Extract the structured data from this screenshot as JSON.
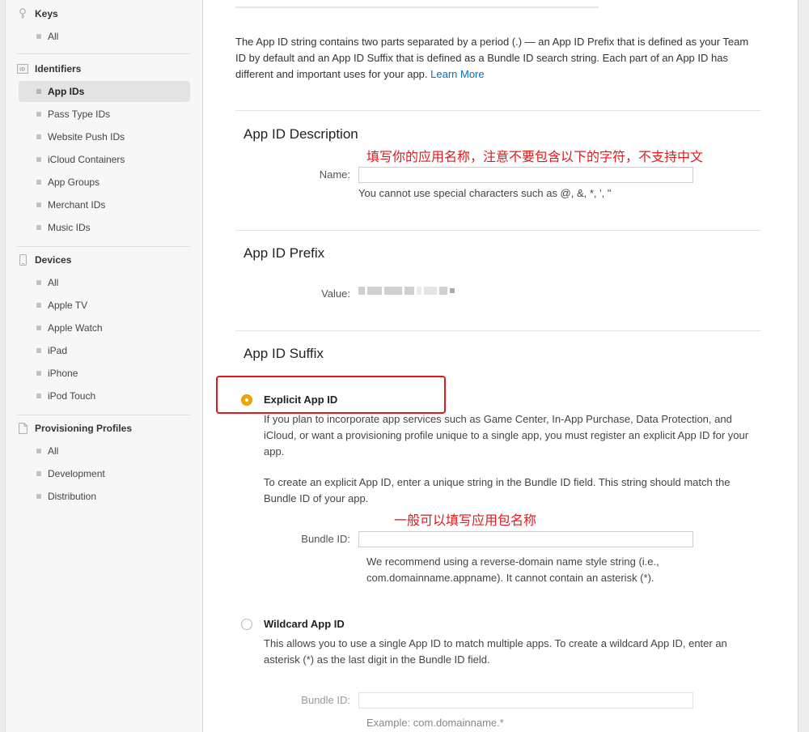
{
  "sidebar": {
    "keys": {
      "title": "Keys",
      "items": [
        "All"
      ]
    },
    "identifiers": {
      "title": "Identifiers",
      "items": [
        "App IDs",
        "Pass Type IDs",
        "Website Push IDs",
        "iCloud Containers",
        "App Groups",
        "Merchant IDs",
        "Music IDs"
      ],
      "active": "App IDs"
    },
    "devices": {
      "title": "Devices",
      "items": [
        "All",
        "Apple TV",
        "Apple Watch",
        "iPad",
        "iPhone",
        "iPod Touch"
      ]
    },
    "profiles": {
      "title": "Provisioning Profiles",
      "items": [
        "All",
        "Development",
        "Distribution"
      ]
    }
  },
  "intro": {
    "text": "The App ID string contains two parts separated by a period (.) — an App ID Prefix that is defined as your Team ID by default and an App ID Suffix that is defined as a Bundle ID search string. Each part of an App ID has different and important uses for your app.",
    "link": "Learn More"
  },
  "description": {
    "heading": "App ID Description",
    "annotation": "填写你的应用名称，注意不要包含以下的字符，不支持中文",
    "name_label": "Name:",
    "name_value": "",
    "hint": "You cannot use special characters such as @, &, *, ', \""
  },
  "prefix": {
    "heading": "App ID Prefix",
    "value_label": "Value:"
  },
  "suffix": {
    "heading": "App ID Suffix",
    "explicit": {
      "label": "Explicit App ID",
      "selected": true,
      "para1": "If you plan to incorporate app services such as Game Center, In-App Purchase, Data Protection, and iCloud, or want a provisioning profile unique to a single app, you must register an explicit App ID for your app.",
      "para2": "To create an explicit App ID, enter a unique string in the Bundle ID field. This string should match the Bundle ID of your app.",
      "annotation": "一般可以填写应用包名称",
      "bundle_label": "Bundle ID:",
      "bundle_value": "",
      "hint": "We recommend using a reverse-domain name style string (i.e., com.domainname.appname). It cannot contain an asterisk (*)."
    },
    "wildcard": {
      "label": "Wildcard App ID",
      "selected": false,
      "para": "This allows you to use a single App ID to match multiple apps. To create a wildcard App ID, enter an asterisk (*) as the last digit in the Bundle ID field.",
      "bundle_label": "Bundle ID:",
      "bundle_value": "",
      "hint": "Example: com.domainname.*"
    }
  },
  "colors": {
    "accent": "#0070c9",
    "radio_selected": "#f0a500",
    "annotation": "#e0191b"
  }
}
